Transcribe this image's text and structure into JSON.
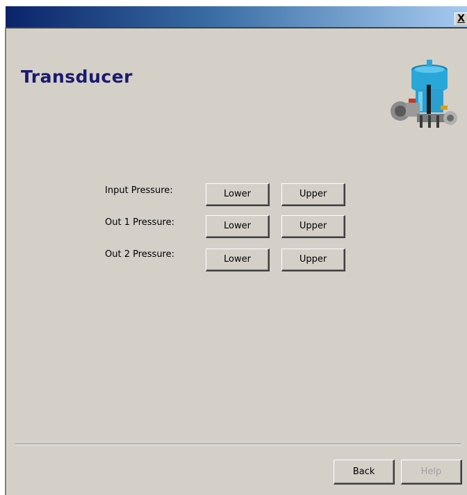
{
  "window": {
    "close_label": "X"
  },
  "page": {
    "title": "Transducer"
  },
  "device_image": {
    "icon": "valve-actuator-image",
    "body_color": "#2aa7d9"
  },
  "rows": [
    {
      "label": "Input Pressure:",
      "lower": "Lower",
      "upper": "Upper"
    },
    {
      "label": "Out 1 Pressure:",
      "lower": "Lower",
      "upper": "Upper"
    },
    {
      "label": "Out 2 Pressure:",
      "lower": "Lower",
      "upper": "Upper"
    }
  ],
  "footer": {
    "back_label": "Back",
    "help_label": "Help",
    "help_enabled": false
  },
  "colors": {
    "title_color": "#1a1a6e",
    "window_bg": "#d4d0c8"
  }
}
